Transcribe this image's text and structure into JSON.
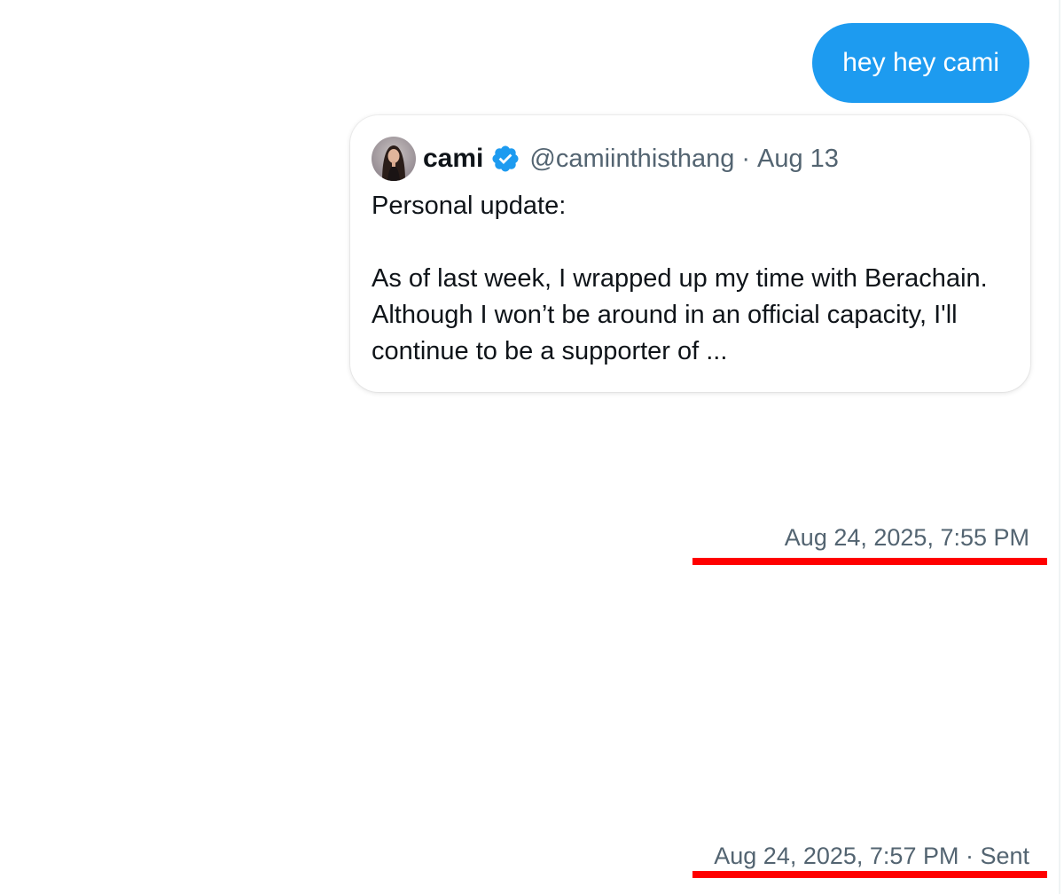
{
  "message": {
    "text": "hey hey cami"
  },
  "quoted_tweet": {
    "author_name": "cami",
    "handle": "@camiinthisthang",
    "separator": "·",
    "date": "Aug 13",
    "text": "Personal update:\n\nAs of last week, I wrapped up my time with Berachain. Although I won’t be around in an official capacity, I'll continue to be a supporter of ...",
    "verified_icon": "verified-badge-icon",
    "colors": {
      "verified": "#1d9bf0"
    }
  },
  "timestamps": {
    "first": "Aug 24, 2025, 7:55 PM",
    "second": "Aug 24, 2025, 7:57 PM · Sent"
  },
  "colors": {
    "bubble": "#1d9bf0",
    "secondary_text": "#536471",
    "annotation_underline": "#ff0000"
  }
}
